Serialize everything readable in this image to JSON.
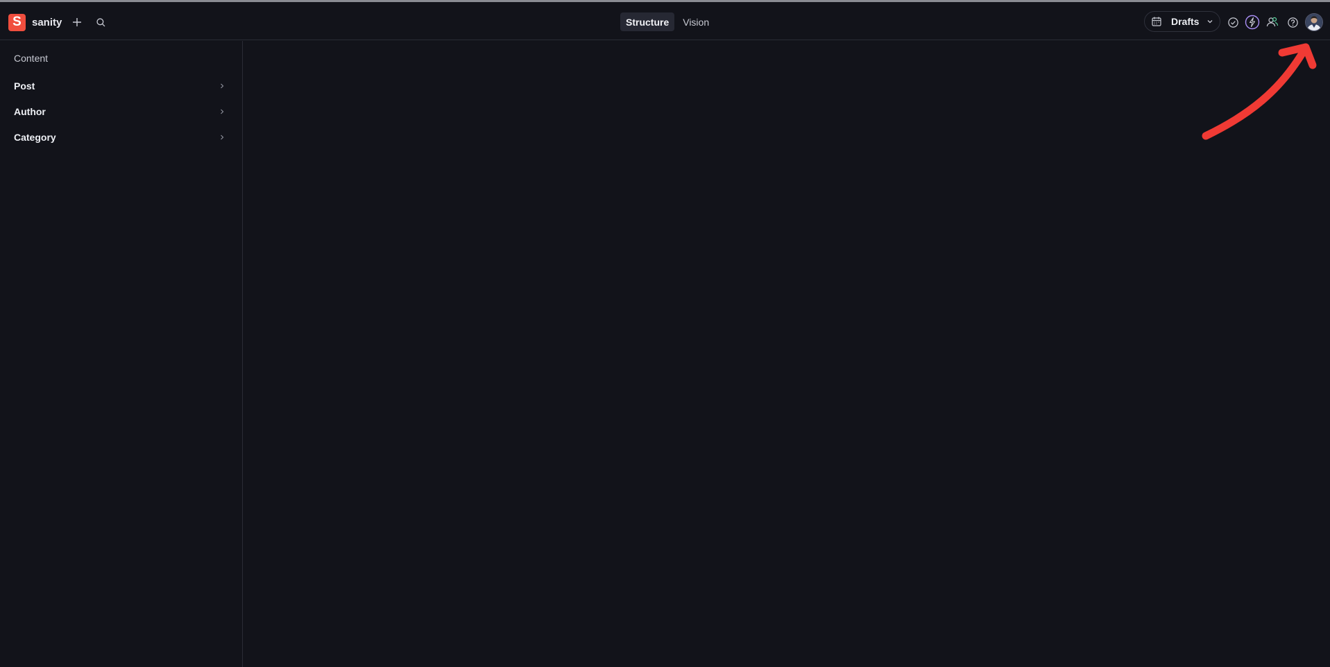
{
  "brand": {
    "name": "sanity",
    "logo_letter": "S",
    "logo_color": "#f04e3e"
  },
  "navbar": {
    "tabs": [
      {
        "label": "Structure",
        "active": true
      },
      {
        "label": "Vision",
        "active": false
      }
    ],
    "drafts_label": "Drafts",
    "icons": [
      "plus-icon",
      "search-icon",
      "calendar-icon",
      "check-circle-icon",
      "bolt-icon",
      "users-icon",
      "help-icon",
      "user-avatar"
    ]
  },
  "sidebar": {
    "title": "Content",
    "items": [
      {
        "label": "Post"
      },
      {
        "label": "Author"
      },
      {
        "label": "Category"
      }
    ]
  },
  "annotation": {
    "color": "#f03a34"
  }
}
